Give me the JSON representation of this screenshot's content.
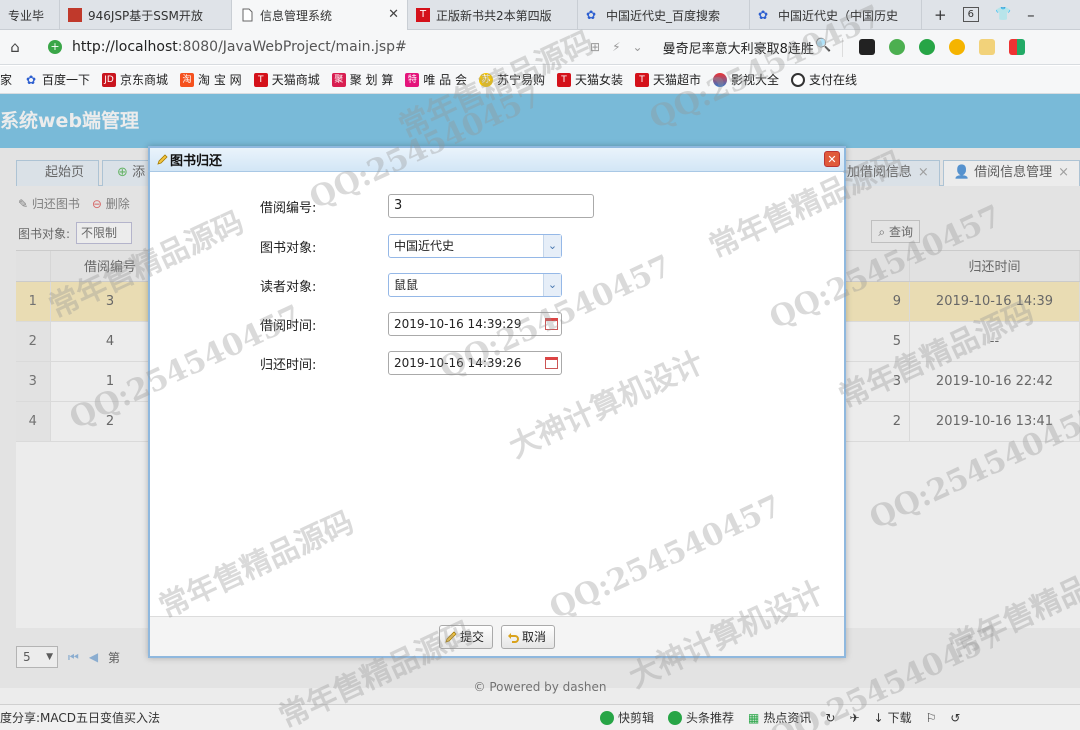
{
  "browser": {
    "tabs": [
      {
        "label": "专业毕"
      },
      {
        "label": "946JSP基于SSM开放"
      },
      {
        "label": "信息管理系统",
        "active": true
      },
      {
        "label": "正版新书共2本第四版"
      },
      {
        "label": "中国近代史_百度搜索"
      },
      {
        "label": "中国近代史（中国历史"
      }
    ],
    "tab_count": "6",
    "url_host": "http://localhost",
    "url_rest": ":8080/JavaWebProject/main.jsp#",
    "search_text": "曼奇尼率意大利豪取8连胜",
    "bookmarks": [
      "百度一下",
      "京东商城",
      "淘 宝 网",
      "天猫商城",
      "聚 划 算",
      "唯 品 会",
      "苏宁易购",
      "天猫女装",
      "天猫超市",
      "影视大全",
      "支付在线"
    ],
    "bookmark_prefix": "家"
  },
  "app": {
    "title": "系统web端管理",
    "tabs_left": [
      "起始页",
      "添"
    ],
    "tabs_right": [
      "加借阅信息",
      "借阅信息管理"
    ],
    "toolbar": {
      "return_label": "归还图书",
      "delete_label": "删除"
    },
    "filter": {
      "label": "图书对象:",
      "value": "不限制",
      "query_label": "查询"
    },
    "grid": {
      "columns": [
        "借阅编号",
        "归还时间"
      ],
      "rows": [
        {
          "n": "1",
          "id": "3",
          "mid": "9",
          "time": "2019-10-16 14:39"
        },
        {
          "n": "2",
          "id": "4",
          "mid": "5",
          "time": "--"
        },
        {
          "n": "3",
          "id": "1",
          "mid": "3",
          "time": "2019-10-16 22:42"
        },
        {
          "n": "4",
          "id": "2",
          "mid": "2",
          "time": "2019-10-16 13:41"
        }
      ]
    },
    "pager": {
      "page_size": "5",
      "page_label": "第"
    },
    "footer": "© Powered by dashen"
  },
  "dialog": {
    "title": "图书归还",
    "fields": {
      "borrow_id_label": "借阅编号:",
      "borrow_id_value": "3",
      "book_label": "图书对象:",
      "book_value": "中国近代史",
      "reader_label": "读者对象:",
      "reader_value": "鼠鼠",
      "borrow_time_label": "借阅时间:",
      "borrow_time_value": "2019-10-16 14:39:29",
      "return_time_label": "归还时间:",
      "return_time_value": "2019-10-16 14:39:26"
    },
    "submit_label": "提交",
    "cancel_label": "取消"
  },
  "statusbar": {
    "left_text": "度分享:MACD五日变值买入法",
    "items": [
      "快剪辑",
      "头条推荐",
      "热点资讯",
      "下载"
    ]
  },
  "watermarks": [
    "QQ:254540457",
    "常年售精品源码",
    "大神计算机设计"
  ]
}
